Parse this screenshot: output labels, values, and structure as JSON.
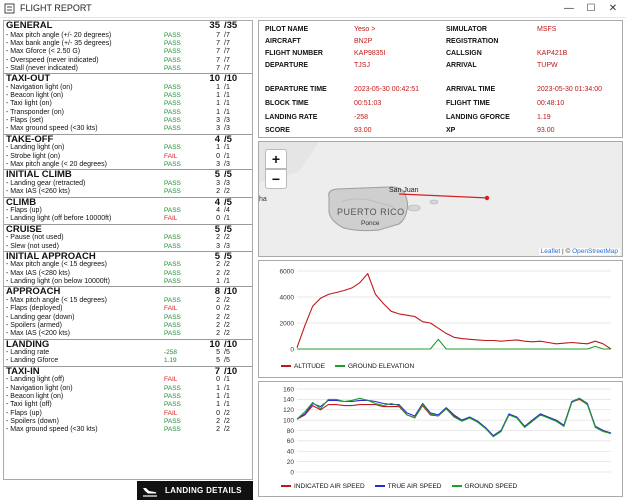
{
  "window": {
    "title": "FLIGHT REPORT",
    "minimize": "—",
    "maximize": "☐",
    "close": "✕"
  },
  "sections": [
    {
      "name": "GENERAL",
      "score": "35",
      "max": "/35",
      "items": [
        {
          "label": "- Max pitch angle (+/- 20 degrees)",
          "result": "PASS",
          "points": "7",
          "max": "/7"
        },
        {
          "label": "- Max bank angle (+/- 35 degrees)",
          "result": "PASS",
          "points": "7",
          "max": "/7"
        },
        {
          "label": "- Max Gforce (< 2.50 G)",
          "result": "PASS",
          "points": "7",
          "max": "/7"
        },
        {
          "label": "- Overspeed (never indicated)",
          "result": "PASS",
          "points": "7",
          "max": "/7"
        },
        {
          "label": "- Stall (never indicated)",
          "result": "PASS",
          "points": "7",
          "max": "/7"
        }
      ]
    },
    {
      "name": "TAXI-OUT",
      "score": "10",
      "max": "/10",
      "items": [
        {
          "label": "- Navigation light (on)",
          "result": "PASS",
          "points": "1",
          "max": "/1"
        },
        {
          "label": "- Beacon light (on)",
          "result": "PASS",
          "points": "1",
          "max": "/1"
        },
        {
          "label": "- Taxi light (on)",
          "result": "PASS",
          "points": "1",
          "max": "/1"
        },
        {
          "label": "- Transponder (on)",
          "result": "PASS",
          "points": "1",
          "max": "/1"
        },
        {
          "label": "- Flaps (set)",
          "result": "PASS",
          "points": "3",
          "max": "/3"
        },
        {
          "label": "- Max ground speed (<30 kts)",
          "result": "PASS",
          "points": "3",
          "max": "/3"
        }
      ]
    },
    {
      "name": "TAKE-OFF",
      "score": "4",
      "max": "/5",
      "items": [
        {
          "label": "- Landing light (on)",
          "result": "PASS",
          "points": "1",
          "max": "/1"
        },
        {
          "label": "- Strobe light (on)",
          "result": "FAIL",
          "points": "0",
          "max": "/1"
        },
        {
          "label": "- Max pitch angle (< 20 degrees)",
          "result": "PASS",
          "points": "3",
          "max": "/3"
        }
      ]
    },
    {
      "name": "INITIAL CLIMB",
      "score": "5",
      "max": "/5",
      "items": [
        {
          "label": "- Landing gear (retracted)",
          "result": "PASS",
          "points": "3",
          "max": "/3"
        },
        {
          "label": "- Max IAS (<260 kts)",
          "result": "PASS",
          "points": "2",
          "max": "/2"
        }
      ]
    },
    {
      "name": "CLIMB",
      "score": "4",
      "max": "/5",
      "items": [
        {
          "label": "- Flaps (up)",
          "result": "PASS",
          "points": "4",
          "max": "/4"
        },
        {
          "label": "- Landing light (off before 10000ft)",
          "result": "FAIL",
          "points": "0",
          "max": "/1"
        }
      ]
    },
    {
      "name": "CRUISE",
      "score": "5",
      "max": "/5",
      "items": [
        {
          "label": "- Pause (not used)",
          "result": "PASS",
          "points": "2",
          "max": "/2"
        },
        {
          "label": "- Slew (not used)",
          "result": "PASS",
          "points": "3",
          "max": "/3"
        }
      ]
    },
    {
      "name": "INITIAL APPROACH",
      "score": "5",
      "max": "/5",
      "items": [
        {
          "label": "- Max pitch angle (< 15 degrees)",
          "result": "PASS",
          "points": "2",
          "max": "/2"
        },
        {
          "label": "- Max IAS (<280 kts)",
          "result": "PASS",
          "points": "2",
          "max": "/2"
        },
        {
          "label": "- Landing light (on below 10000ft)",
          "result": "PASS",
          "points": "1",
          "max": "/1"
        }
      ]
    },
    {
      "name": "APPROACH",
      "score": "8",
      "max": "/10",
      "items": [
        {
          "label": "- Max pitch angle (< 15 degrees)",
          "result": "PASS",
          "points": "2",
          "max": "/2"
        },
        {
          "label": "- Flaps (deployed)",
          "result": "FAIL",
          "points": "0",
          "max": "/2"
        },
        {
          "label": "- Landing gear (down)",
          "result": "PASS",
          "points": "2",
          "max": "/2"
        },
        {
          "label": "- Spoilers (armed)",
          "result": "PASS",
          "points": "2",
          "max": "/2"
        },
        {
          "label": "- Max IAS (<200 kts)",
          "result": "PASS",
          "points": "2",
          "max": "/2"
        }
      ]
    },
    {
      "name": "LANDING",
      "score": "10",
      "max": "/10",
      "items": [
        {
          "label": "- Landing rate",
          "result": "-258",
          "points": "5",
          "max": "/5"
        },
        {
          "label": "- Landing Gforce",
          "result": "1.19",
          "points": "5",
          "max": "/5"
        }
      ]
    },
    {
      "name": "TAXI-IN",
      "score": "7",
      "max": "/10",
      "items": [
        {
          "label": "- Landing light (off)",
          "result": "FAIL",
          "points": "0",
          "max": "/1"
        },
        {
          "label": "- Navigation light (on)",
          "result": "PASS",
          "points": "1",
          "max": "/1"
        },
        {
          "label": "- Beacon light (on)",
          "result": "PASS",
          "points": "1",
          "max": "/1"
        },
        {
          "label": "- Taxi light (off)",
          "result": "PASS",
          "points": "1",
          "max": "/1"
        },
        {
          "label": "- Flaps (up)",
          "result": "FAIL",
          "points": "0",
          "max": "/2"
        },
        {
          "label": "- Spoilers (down)",
          "result": "PASS",
          "points": "2",
          "max": "/2"
        },
        {
          "label": "- Max ground speed (<30 kts)",
          "result": "PASS",
          "points": "2",
          "max": "/2"
        }
      ]
    }
  ],
  "landing_button": {
    "label": "LANDING DETAILS",
    "icon": "landing-plane-icon"
  },
  "flight_info": {
    "left": [
      {
        "key": "PILOT NAME",
        "value": "Yeso >"
      },
      {
        "key": "AIRCRAFT",
        "value": "BN2P"
      },
      {
        "key": "FLIGHT NUMBER",
        "value": "KAP9835I"
      },
      {
        "key": "DEPARTURE",
        "value": "TJSJ"
      },
      {
        "key": "DEPARTURE TIME",
        "value": "2023-05-30 00:42:51"
      },
      {
        "key": "BLOCK TIME",
        "value": "00:51:03"
      },
      {
        "key": "LANDING RATE",
        "value": "-258"
      },
      {
        "key": "SCORE",
        "value": "93.00"
      }
    ],
    "right": [
      {
        "key": "SIMULATOR",
        "value": "MSFS"
      },
      {
        "key": "REGISTRATION",
        "value": ""
      },
      {
        "key": "CALLSIGN",
        "value": "KAP421B"
      },
      {
        "key": "ARRIVAL",
        "value": "TUPW"
      },
      {
        "key": "ARRIVAL TIME",
        "value": "2023-05-30 01:34:00"
      },
      {
        "key": "FLIGHT TIME",
        "value": "00:48:10"
      },
      {
        "key": "LANDING GFORCE",
        "value": "1.19"
      },
      {
        "key": "XP",
        "value": "93.00"
      }
    ]
  },
  "map": {
    "zoom_in": "+",
    "zoom_out": "−",
    "labels": {
      "city": "San Juan",
      "island": "PUERTO RICO",
      "town": "Ponce",
      "edge": "ha"
    },
    "attribution_leaflet": "Leaflet",
    "attribution_sep": " | © ",
    "attribution_osm": "OpenStreetMap",
    "route_color": "#d42020"
  },
  "chart_data": [
    {
      "type": "line",
      "ylim": [
        0,
        6000
      ],
      "yticks": [
        "6000",
        "4000",
        "2000",
        "0"
      ],
      "x": [
        0,
        1,
        2,
        3,
        4,
        5,
        6,
        7,
        8,
        9,
        10,
        11,
        12,
        13,
        14,
        15,
        16,
        17,
        18,
        19,
        20,
        21,
        22,
        23,
        24,
        25,
        26,
        27,
        28,
        29,
        30,
        31,
        32,
        33,
        34,
        35,
        36,
        37,
        38,
        39,
        40
      ],
      "series": [
        {
          "name": "ALTITUDE",
          "color": "#c0181f",
          "values": [
            100,
            1800,
            3300,
            3900,
            4200,
            4350,
            4500,
            4700,
            5100,
            5800,
            4200,
            3500,
            2900,
            2700,
            2600,
            2500,
            2100,
            2000,
            1600,
            1200,
            900,
            800,
            750,
            700,
            650,
            650,
            600,
            650,
            700,
            600,
            550,
            600,
            500,
            400,
            450,
            500,
            450,
            400,
            600,
            400,
            0
          ]
        },
        {
          "name": "GROUND ELEVATION",
          "color": "#1f9e2b",
          "values": [
            0,
            0,
            0,
            0,
            0,
            0,
            0,
            0,
            0,
            0,
            0,
            0,
            0,
            0,
            0,
            0,
            0,
            0,
            750,
            0,
            0,
            0,
            0,
            0,
            0,
            0,
            0,
            0,
            0,
            0,
            0,
            0,
            0,
            0,
            0,
            0,
            0,
            0,
            200,
            0,
            0
          ]
        }
      ]
    },
    {
      "type": "line",
      "ylim": [
        0,
        160
      ],
      "yticks": [
        "160",
        "140",
        "120",
        "100",
        "80",
        "60",
        "40",
        "20",
        "0"
      ],
      "x": [
        0,
        1,
        2,
        3,
        4,
        5,
        6,
        7,
        8,
        9,
        10,
        11,
        12,
        13,
        14,
        15,
        16,
        17,
        18,
        19,
        20,
        21,
        22,
        23,
        24,
        25,
        26,
        27,
        28,
        29,
        30,
        31,
        32,
        33,
        34,
        35,
        36,
        37,
        38,
        39,
        40
      ],
      "series": [
        {
          "name": "INDICATED AIR SPEED",
          "color": "#c0181f",
          "values": [
            102,
            110,
            128,
            120,
            130,
            130,
            128,
            128,
            130,
            130,
            130,
            126,
            126,
            126,
            110,
            105,
            128,
            110,
            108,
            122,
            108,
            100,
            105,
            98,
            85,
            70,
            80,
            110,
            105,
            88,
            100,
            112,
            105,
            100,
            90,
            135,
            140,
            130,
            88,
            80,
            75
          ]
        },
        {
          "name": "TRUE AIR SPEED",
          "color": "#2b2bd0",
          "values": [
            102,
            112,
            132,
            126,
            138,
            138,
            136,
            136,
            138,
            138,
            136,
            132,
            130,
            130,
            114,
            108,
            132,
            114,
            110,
            124,
            110,
            100,
            106,
            98,
            86,
            70,
            80,
            112,
            106,
            88,
            100,
            112,
            106,
            100,
            90,
            136,
            142,
            132,
            88,
            80,
            75
          ]
        },
        {
          "name": "GROUND SPEED",
          "color": "#1f9e2b",
          "values": [
            102,
            116,
            134,
            122,
            140,
            140,
            136,
            138,
            142,
            138,
            132,
            128,
            132,
            128,
            110,
            104,
            130,
            112,
            108,
            122,
            106,
            98,
            104,
            96,
            84,
            68,
            78,
            110,
            104,
            86,
            98,
            110,
            104,
            98,
            88,
            134,
            142,
            130,
            86,
            78,
            74
          ]
        }
      ]
    }
  ]
}
